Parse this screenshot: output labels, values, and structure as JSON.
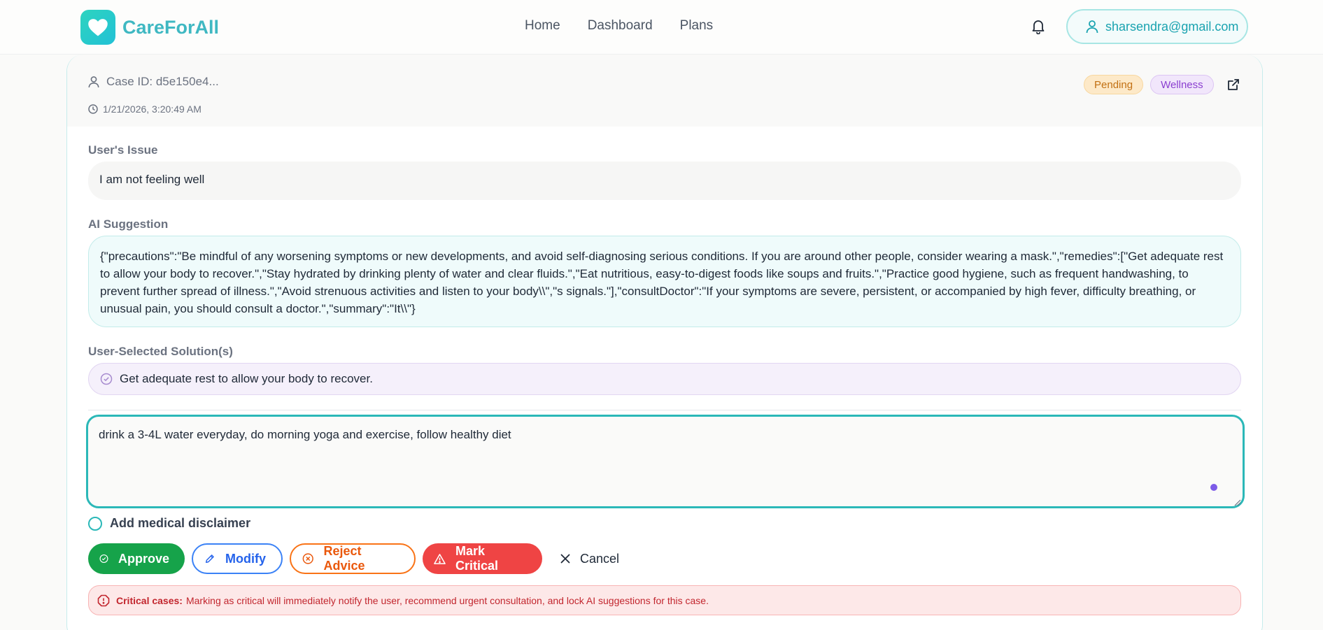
{
  "nav": {
    "brand": "CareForAll",
    "links": [
      "Home",
      "Dashboard",
      "Plans"
    ],
    "user_email": "sharsendra@gmail.com"
  },
  "case": {
    "id_label": "Case ID: d5e150e4...",
    "timestamp": "1/21/2026, 3:20:49 AM",
    "status": "Pending",
    "category": "Wellness"
  },
  "issue": {
    "label": "User's Issue",
    "text": "I am not feeling well"
  },
  "ai": {
    "label": "AI Suggestion",
    "text": "{\"precautions\":\"Be mindful of any worsening symptoms or new developments, and avoid self-diagnosing serious conditions. If you are around other people, consider wearing a mask.\",\"remedies\":[\"Get adequate rest to allow your body to recover.\",\"Stay hydrated by drinking plenty of water and clear fluids.\",\"Eat nutritious, easy-to-digest foods like soups and fruits.\",\"Practice good hygiene, such as frequent handwashing, to prevent further spread of illness.\",\"Avoid strenuous activities and listen to your body\\\\\",\"s signals.\"],\"consultDoctor\":\"If your symptoms are severe, persistent, or accompanied by high fever, difficulty breathing, or unusual pain, you should consult a doctor.\",\"summary\":\"It\\\\\"}"
  },
  "solutions": {
    "label": "User-Selected Solution(s)",
    "items": [
      "Get adequate rest to allow your body to recover."
    ]
  },
  "response": {
    "value": "drink a 3-4L water everyday, do morning yoga and exercise, follow healthy diet"
  },
  "disclaimer_label": "Add medical disclaimer",
  "actions": {
    "approve": "Approve",
    "modify": "Modify",
    "reject": "Reject Advice",
    "critical": "Mark Critical",
    "cancel": "Cancel"
  },
  "alert": {
    "title": "Critical cases:",
    "text": "Marking as critical will immediately notify the user, recommend urgent consultation, and lock AI suggestions for this case."
  },
  "colors": {
    "brand": "#3fb8c2",
    "approve": "#16a34a",
    "modify": "#2563eb",
    "reject": "#ea580c",
    "critical": "#ef4444"
  }
}
